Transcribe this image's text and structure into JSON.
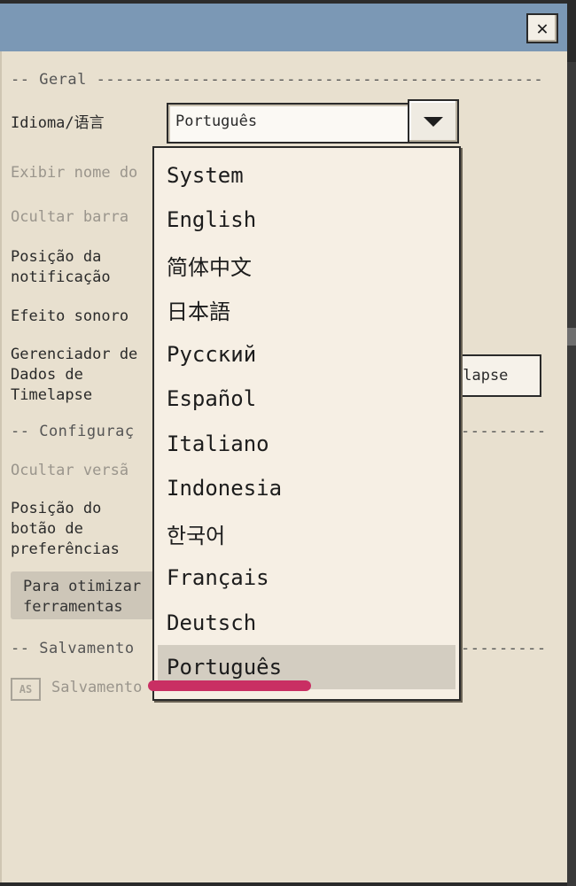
{
  "window": {
    "close_glyph": "✕"
  },
  "sections": {
    "general": "-- Geral ---------------------------------------------------------",
    "config": "-- Configuraç",
    "config_tail": "-----------------",
    "save": "-- Salvamento",
    "save_tail": "-----------------"
  },
  "settings": {
    "language_label": "Idioma/语言",
    "show_name_label": "Exibir nome do",
    "hide_bar_label": "Ocultar barra",
    "notif_position_label": "Posição da\nnotificação",
    "sound_label": "Efeito sonoro",
    "timelapse_label": "Gerenciador de\nDados de\nTimelapse",
    "timelapse_button": "elapse",
    "hide_version_label": "Ocultar versã",
    "pref_button_position_label": "Posição do\nbotão de\npreferências",
    "info_text": "Para otimizar\nferramentas",
    "autosave_icon_text": "AS",
    "autosave_label": "Salvamento"
  },
  "language_select": {
    "value": "Português",
    "options": [
      "System",
      "English",
      "简体中文",
      "日本語",
      "Русский",
      "Español",
      "Italiano",
      "Indonesia",
      "한국어",
      "Français",
      "Deutsch",
      "Português"
    ],
    "selected_index": 11
  },
  "colors": {
    "titlebar": "#7b98b5",
    "highlight_underline": "#c92f63"
  }
}
